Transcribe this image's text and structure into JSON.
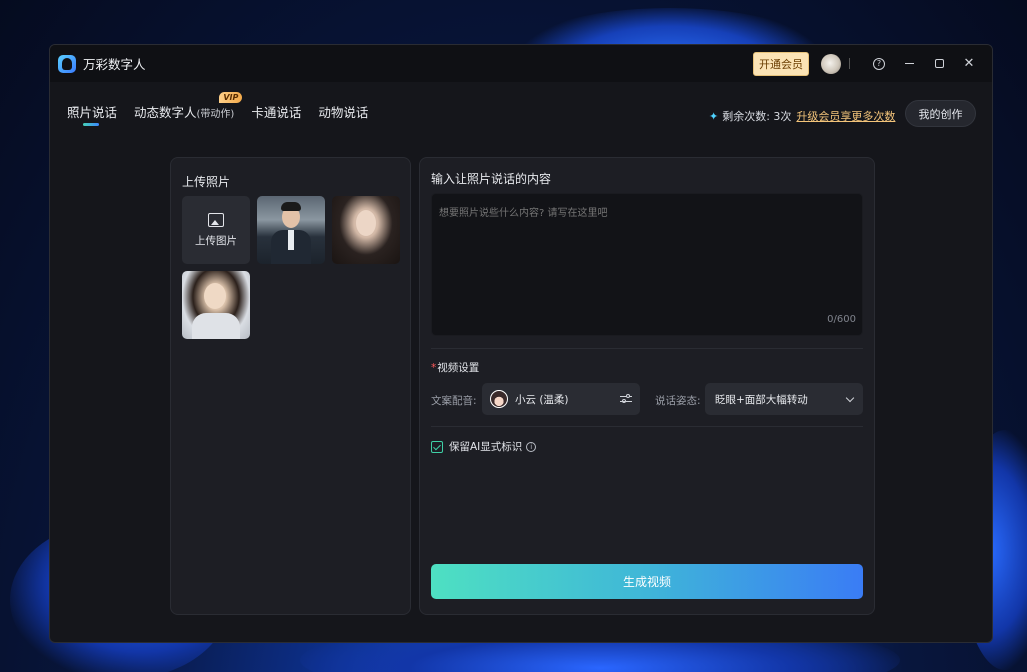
{
  "window": {
    "title": "万彩数字人"
  },
  "titlebar": {
    "vip_button": "开通会员",
    "help_icon": "?"
  },
  "nav": {
    "tabs": [
      {
        "label": "照片说话",
        "active": true
      },
      {
        "label": "动态数字人",
        "sub": "(带动作)",
        "badge": "VIP"
      },
      {
        "label": "卡通说话"
      },
      {
        "label": "动物说话"
      }
    ],
    "remaining": "剩余次数: 3次",
    "upgrade_link": "升级会员享更多次数",
    "my_creations": "我的创作"
  },
  "upload_panel": {
    "title": "上传照片",
    "upload_label": "上传图片",
    "photos": [
      "photo-man-suit",
      "photo-woman-long-hair",
      "photo-woman-blazer"
    ]
  },
  "content_panel": {
    "title": "输入让照片说话的内容",
    "placeholder": "想要照片说些什么内容? 请写在这里吧",
    "counter": "0/600",
    "video_settings": {
      "required_mark": "*",
      "title": "视频设置",
      "voice_label": "文案配音:",
      "voice_value": "小云 (温柔)",
      "pose_label": "说话姿态:",
      "pose_value": "眨眼+面部大幅转动"
    },
    "keep_ai_label": "保留AI显式标识",
    "keep_ai_checked": true,
    "generate_button": "生成视频"
  },
  "colors": {
    "accent_start": "#4ee0c2",
    "accent_end": "#3a7cf5",
    "vip_gold": "#f3c47a"
  }
}
